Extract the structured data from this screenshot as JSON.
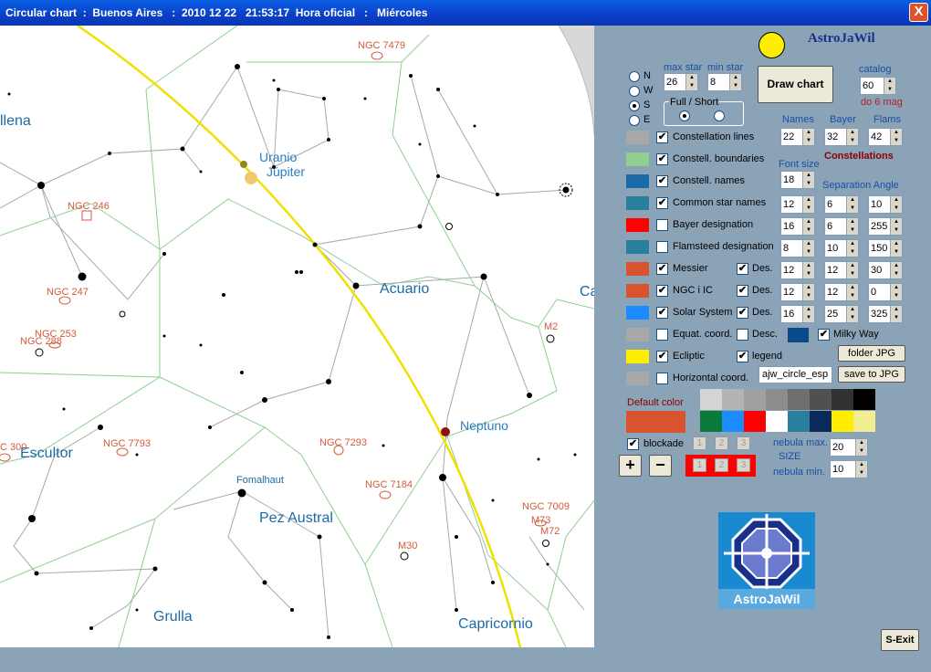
{
  "window": {
    "title": "Circular chart  :  Buenos Aires   :  2010 12 22   21:53:17  Hora oficial   :   Miércoles",
    "close": "X"
  },
  "chart_labels": {
    "uranio": "Uranio",
    "jupiter": "Júpiter",
    "acuario": "Acuario",
    "neptuno": "Neptuno",
    "escultor": "Escultor",
    "pez_austral": "Pez Austral",
    "grulla": "Grulla",
    "capricornio": "Capricornio",
    "fomalhaut": "Fomalhaut",
    "ballena": "llena",
    "ca": "Ca",
    "ngc7479": "NGC 7479",
    "ngc246": "NGC 246",
    "ngc247": "NGC  247",
    "ngc253": "NGC  253",
    "ngc288": "NGC 288",
    "ngc300": "C 300",
    "ngc7793": "NGC 7793",
    "ngc7293": "NGC 7293",
    "ngc7184": "NGC 7184",
    "ngc7009": "NGC 7009",
    "m2": "M2",
    "m73": "M73",
    "m72": "M72",
    "m30": "M30"
  },
  "panel": {
    "app_name": "AstroJaWil",
    "directions": [
      "N",
      "W",
      "S",
      "E"
    ],
    "selected_direction": "S",
    "max_star_label": "max star",
    "max_star": "26",
    "min_star_label": "min star",
    "min_star": "8",
    "draw_chart": "Draw chart",
    "catalog_label": "catalog",
    "catalog": "60",
    "catalog_note": "do 6 mag",
    "full_short_label": "Full / Short",
    "col_names": "Names",
    "col_bayer": "Bayer",
    "col_flams": "Flams",
    "names_val": "22",
    "bayer_val": "32",
    "flams_val": "42",
    "constellations_heading": "Constellations",
    "font_size_label": "Font size",
    "font_size": "18",
    "separation_angle": "Separation Angle",
    "rows": [
      {
        "label": "Constellation lines",
        "color": "#a8a8a8",
        "checked": true
      },
      {
        "label": "Constell. boundaries",
        "color": "#8fcf8f",
        "checked": true
      },
      {
        "label": "Constell. names",
        "color": "#1a6aa8",
        "checked": true
      },
      {
        "label": "Common star names",
        "color": "#2a7e9e",
        "checked": true,
        "v1": "12",
        "v2": "6",
        "v3": "10"
      },
      {
        "label": "Bayer designation",
        "color": "#ff0000",
        "checked": false,
        "v1": "16",
        "v2": "6",
        "v3": "255"
      },
      {
        "label": "Flamsteed designation",
        "color": "#2a7e9e",
        "checked": false,
        "v1": "8",
        "v2": "10",
        "v3": "150"
      },
      {
        "label": "Messier",
        "color": "#d9542e",
        "checked": true,
        "des": "Des.",
        "des_checked": true,
        "v1": "12",
        "v2": "12",
        "v3": "30"
      },
      {
        "label": "NGC  i  IC",
        "color": "#d9542e",
        "checked": true,
        "des": "Des.",
        "des_checked": true,
        "v1": "12",
        "v2": "12",
        "v3": "0"
      },
      {
        "label": "Solar System",
        "color": "#1a8cff",
        "checked": true,
        "des": "Des.",
        "des_checked": true,
        "v1": "16",
        "v2": "25",
        "v3": "325"
      },
      {
        "label": "Equat. coord.",
        "color": "#a8a8a8",
        "checked": false,
        "des": "Desc.",
        "des_checked": false
      },
      {
        "label": "Ecliptic",
        "color": "#ffee00",
        "checked": true,
        "des": "legend",
        "des_checked": true
      },
      {
        "label": "Horizontal coord.",
        "color": "#a8a8a8",
        "checked": false
      }
    ],
    "milky_way": "Milky Way",
    "milky_way_color": "#0a4a8a",
    "folder_jpg": "folder JPG",
    "save_jpg": "save to JPG",
    "filename": "ajw_circle_esp",
    "default_color_label": "Default color",
    "default_color": "#d9542e",
    "palette": [
      "#d4d4d4",
      "#b4b4b4",
      "#a0a0a0",
      "#8c8c8c",
      "#6e6e6e",
      "#505050",
      "#323232",
      "#000000",
      "#0a7a3a",
      "#1a8cff",
      "#ff0000",
      "#ffffff",
      "#2a7e9e",
      "#0a2a5a",
      "#ffee00",
      "#f0ee90",
      "#d9542e"
    ],
    "blockade": "blockade",
    "mini_buttons": [
      "1",
      "2",
      "3"
    ],
    "plus": "+",
    "minus": "−",
    "nebula_max_label": "nebula max.",
    "nebula_max": "20",
    "size_label": "SIZE",
    "nebula_min_label": "nebula min.",
    "nebula_min": "10",
    "logo_text": "AstroJaWil",
    "exit": "S-Exit"
  }
}
